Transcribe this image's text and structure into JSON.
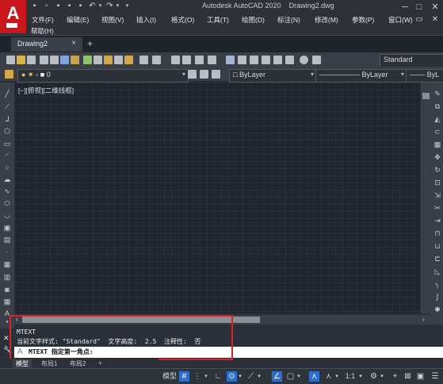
{
  "app": {
    "title": "Autodesk AutoCAD 2020",
    "document": "Drawing2.dwg",
    "logo_letter": "A"
  },
  "menu": {
    "items": [
      "文件(F)",
      "编辑(E)",
      "视图(V)",
      "插入(I)",
      "格式(O)",
      "工具(T)",
      "绘图(D)",
      "标注(N)",
      "修改(M)",
      "参数(P)",
      "窗口(W)"
    ],
    "help": "帮助(H)"
  },
  "tabs": {
    "document_tab": "Drawing2",
    "close": "×",
    "new": "+"
  },
  "toolbar": {
    "text_style": "Standard",
    "layer_name": "0",
    "color": "ByLayer",
    "linetype": "ByLayer",
    "lineweight": "ByL"
  },
  "viewport": {
    "label": "[−][俯视][二维线框]"
  },
  "command": {
    "history_line1": "MTEXT",
    "history_line2": "当前文字样式: \"Standard\"  文字高度:  2.5  注释性:  否",
    "prompt": "MTEXT 指定第一角点:"
  },
  "layout_tabs": [
    "模型",
    "布局1",
    "布局2",
    "+"
  ],
  "status": {
    "model": "模型",
    "scale": "1:1"
  },
  "colors": {
    "accent": "#2d6fd0",
    "highlight_box": "#d9232a",
    "logo": "#c8181e"
  }
}
